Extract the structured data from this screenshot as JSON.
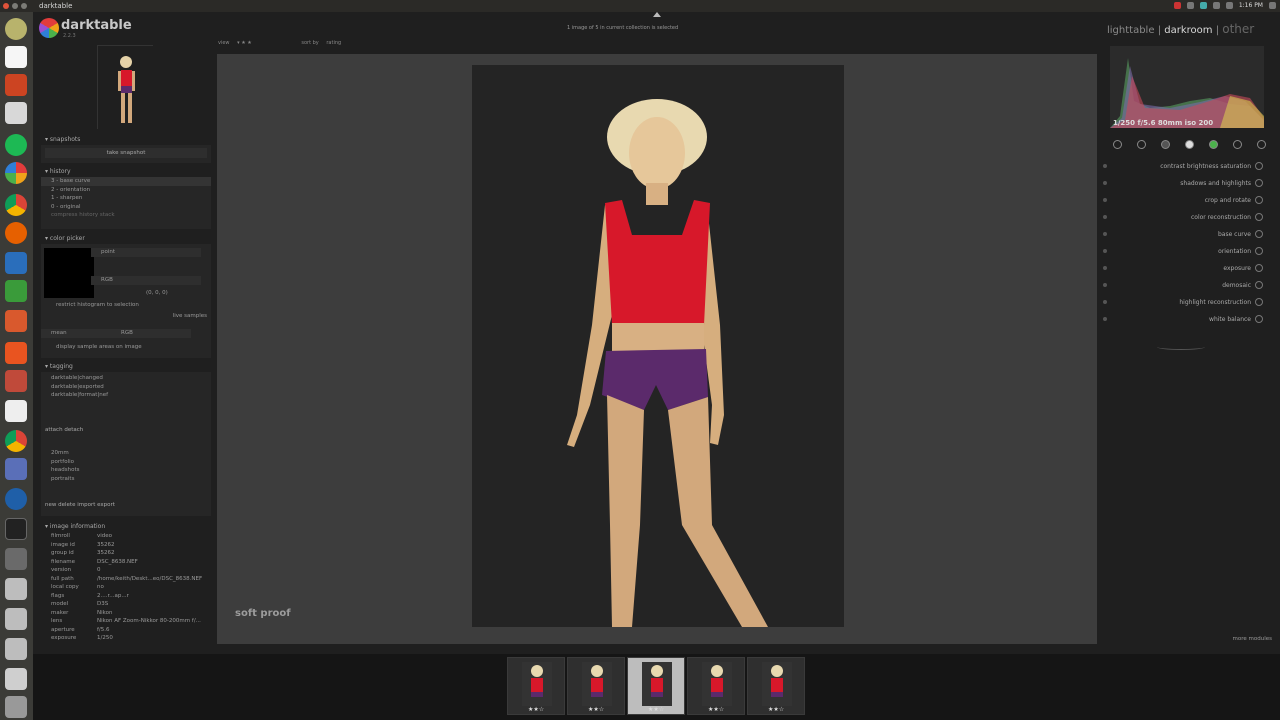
{
  "system": {
    "app_title": "darktable",
    "clock": "1:16 PM"
  },
  "header": {
    "logo_text": "darktable",
    "version": "2.2.3",
    "status": "1 image of 5 in current collection is selected"
  },
  "toolbar": {
    "view_label": "view",
    "sort_label": "sort by",
    "sort_value": "rating"
  },
  "views": {
    "lighttable": "lighttable",
    "sep1": "|",
    "darkroom": "darkroom",
    "sep2": "|",
    "other": "other"
  },
  "left": {
    "snapshots": {
      "title": "snapshots",
      "button": "take snapshot"
    },
    "history": {
      "title": "history",
      "items": [
        "3 - base curve",
        "2 - orientation",
        "1 - sharpen",
        "0 - original"
      ],
      "compress": "compress history stack"
    },
    "color_picker": {
      "title": "color picker",
      "mode": "point",
      "colorspace": "RGB",
      "value": "(0, 0, 0)",
      "restrict": "restrict histogram to selection",
      "live_samples": "live samples",
      "stat": "mean",
      "stat_space": "RGB",
      "display_samples": "display sample areas on image"
    },
    "tagging": {
      "title": "tagging",
      "attached": [
        "darktable|changed",
        "darktable|exported",
        "darktable|format|nef"
      ],
      "attach": "attach",
      "detach": "detach",
      "dictionary": [
        "20mm",
        "portfolio",
        "headshots",
        "portraits"
      ],
      "new": "new",
      "delete": "delete",
      "import": "import",
      "export": "export"
    },
    "image_info": {
      "title": "image information",
      "rows": [
        {
          "k": "filmroll",
          "v": "video"
        },
        {
          "k": "image id",
          "v": "35262"
        },
        {
          "k": "group id",
          "v": "35262"
        },
        {
          "k": "filename",
          "v": "DSC_8638.NEF"
        },
        {
          "k": "version",
          "v": "0"
        },
        {
          "k": "full path",
          "v": "/home/keith/Deskt...eo/DSC_8638.NEF"
        },
        {
          "k": "local copy",
          "v": "no"
        },
        {
          "k": "flags",
          "v": "2....r...ap...r"
        },
        {
          "k": "model",
          "v": "D3S"
        },
        {
          "k": "maker",
          "v": "Nikon"
        },
        {
          "k": "lens",
          "v": "Nikon AF Zoom-Nikkor 80-200mm f/..."
        },
        {
          "k": "aperture",
          "v": "f/5.6"
        },
        {
          "k": "exposure",
          "v": "1/250"
        }
      ]
    }
  },
  "center": {
    "soft_proof": "soft proof"
  },
  "right": {
    "histogram_label": "1/250 f/5.6 80mm iso 200",
    "modules": [
      "contrast brightness saturation",
      "shadows and highlights",
      "crop and rotate",
      "color reconstruction",
      "base curve",
      "orientation",
      "exposure",
      "demosaic",
      "highlight reconstruction",
      "white balance"
    ],
    "more_modules": "more modules"
  },
  "filmstrip": {
    "count": 5,
    "selected_index": 2,
    "stars": "★★☆"
  },
  "colors": {
    "bg": "#1f1f1f",
    "canvas": "#3d3d3d",
    "top": "#d7182a",
    "shorts": "#5b2a6b"
  }
}
